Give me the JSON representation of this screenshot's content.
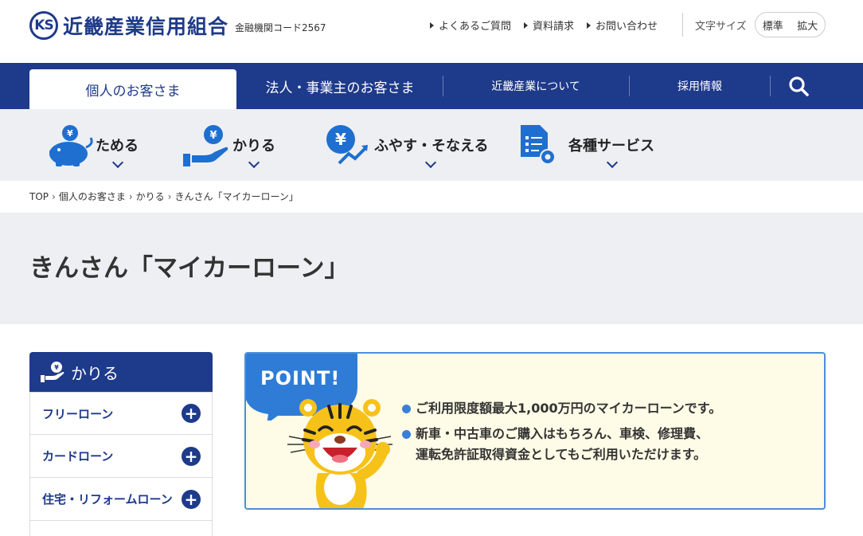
{
  "header": {
    "logo_mark": "KS",
    "logo_name": "近畿産業信用組合",
    "bank_code": "金融機関コード2567",
    "util_links": [
      "よくあるご質問",
      "資料請求",
      "お問い合わせ"
    ],
    "font_size_label": "文字サイズ",
    "font_size_options": [
      "標準",
      "拡大"
    ]
  },
  "nav": {
    "tabs": [
      "個人のお客さま",
      "法人・事業主のお客さま",
      "近畿産業について",
      "採用情報"
    ],
    "search_icon": "search-icon"
  },
  "categories": [
    {
      "label": "ためる",
      "icon": "piggy-bank-icon"
    },
    {
      "label": "かりる",
      "icon": "hand-yen-icon"
    },
    {
      "label": "ふやす・そなえる",
      "icon": "yen-growth-icon"
    },
    {
      "label": "各種サービス",
      "icon": "document-gear-icon"
    }
  ],
  "breadcrumb": [
    "TOP",
    "個人のお客さま",
    "かりる",
    "きんさん「マイカーローン」"
  ],
  "page_title": "きんさん「マイカーローン」",
  "sidebar": {
    "heading": "かりる",
    "items": [
      "フリーローン",
      "カードローン",
      "住宅・リフォームローン"
    ]
  },
  "point": {
    "badge": "POINT!",
    "lines": [
      "ご利用限度額最大1,000万円のマイカーローンです。",
      "新車・中古車のご購入はもちろん、車検、修理費、",
      "運転免許証取得資金としてもご利用いただけます。"
    ]
  },
  "colors": {
    "primary": "#1e3a8a",
    "accent": "#3a7fd5",
    "point_bg": "#fefbe6"
  }
}
